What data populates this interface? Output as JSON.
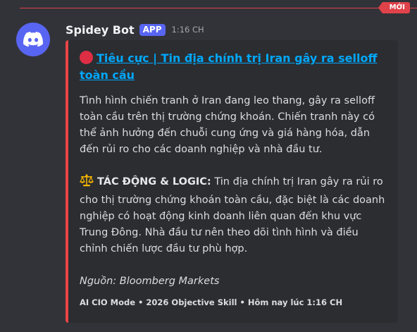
{
  "divider": {
    "badge": "MỚI"
  },
  "message": {
    "author": "Spidey Bot",
    "tag": "APP",
    "timestamp": "1:16 CH",
    "avatar_icon": "discord-logo-icon",
    "colors": {
      "avatar_bg": "#5865f2",
      "embed_accent": "#ea4446",
      "link": "#00a8fc",
      "new_badge": "#e0424a"
    }
  },
  "embed": {
    "title_icon": "red-circle-icon",
    "title": "Tiêu cực | Tin địa chính trị Iran gây ra selloff toàn cầu",
    "description": "Tình hình chiến tranh ở Iran đang leo thang, gây ra selloff toàn cầu trên thị trường chứng khoán. Chiến tranh này có thể ảnh hưởng đến chuỗi cung ứng và giá hàng hóa, dẫn đến rủi ro cho các doanh nghiệp và nhà đầu tư.",
    "impact_icon": "balance-scale-icon",
    "impact_label": "TÁC ĐỘNG & LOGIC:",
    "impact_text": " Tin địa chính trị Iran gây ra rủi ro cho thị trường chứng khoán toàn cầu, đặc biệt là các doanh nghiệp có hoạt động kinh doanh liên quan đến khu vực Trung Đông. Nhà đầu tư nên theo dõi tình hình và điều chỉnh chiến lược đầu tư phù hợp.",
    "source": "Nguồn: Bloomberg Markets",
    "footer": "AI CIO Mode • 2026 Objective Skill • Hôm nay lúc 1:16 CH"
  }
}
